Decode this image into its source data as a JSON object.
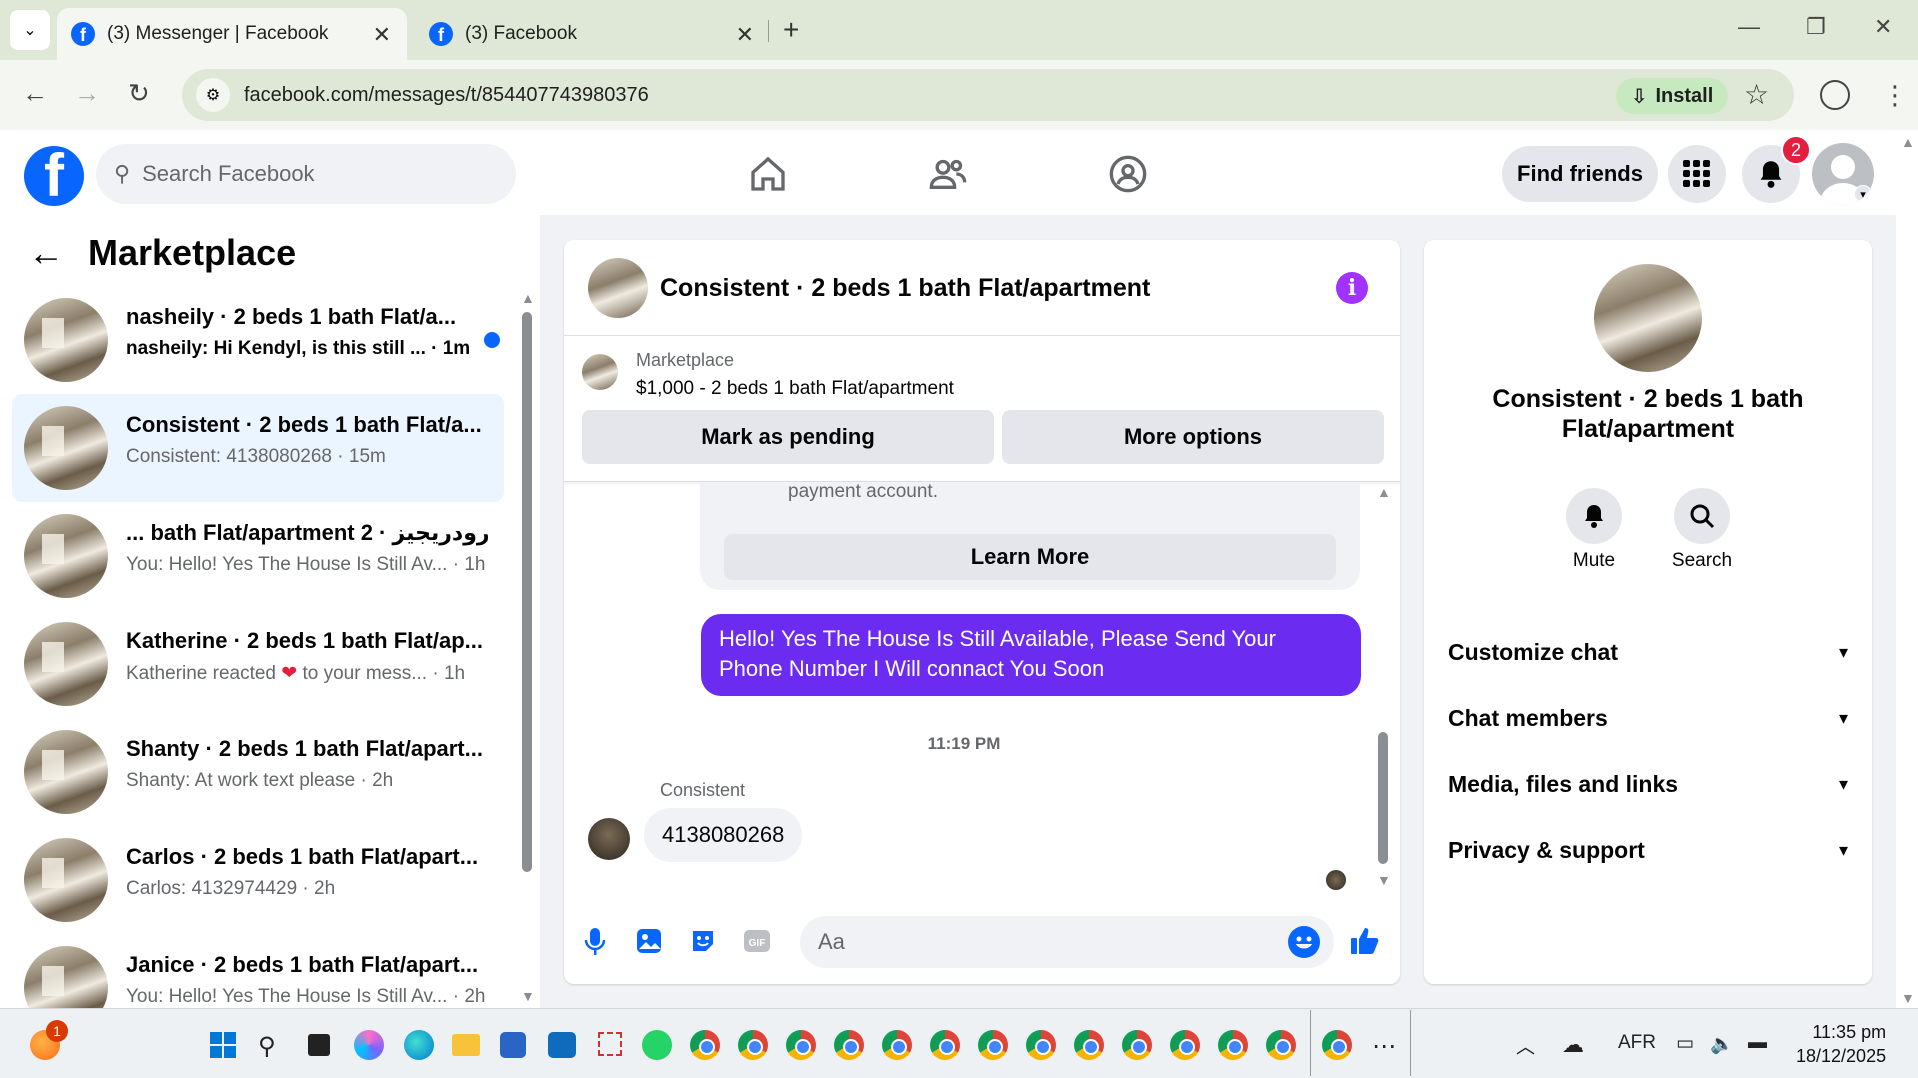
{
  "browser": {
    "tabs": [
      {
        "title": "(3) Messenger | Facebook",
        "active": true
      },
      {
        "title": "(3) Facebook",
        "active": false
      }
    ],
    "url": "facebook.com/messages/t/854407743980376",
    "install_label": "Install"
  },
  "fb": {
    "search_placeholder": "Search Facebook",
    "find_friends": "Find friends",
    "notification_count": "2",
    "brand_color": "#0866ff"
  },
  "sidebar": {
    "title": "Marketplace",
    "conversations": [
      {
        "title": "nasheily · 2 beds 1 bath Flat/a...",
        "preview": "nasheily: Hi Kendyl, is this still ... · 1m",
        "unread": true
      },
      {
        "title": "Consistent · 2 beds 1 bath Flat/a...",
        "preview": "Consistent: 4138080268 · 15m",
        "selected": true
      },
      {
        "title": "... bath Flat/apartment 2 · رودريجيز",
        "preview": "You: Hello! Yes The House Is Still Av... · 1h"
      },
      {
        "title": "Katherine · 2 beds 1 bath Flat/ap...",
        "preview_a": "Katherine reacted",
        "preview_b": "to your mess... · 1h"
      },
      {
        "title": "Shanty · 2 beds 1 bath Flat/apart...",
        "preview": "Shanty: At work text please · 2h"
      },
      {
        "title": "Carlos · 2 beds 1 bath Flat/apart...",
        "preview": "Carlos: 4132974429 · 2h"
      },
      {
        "title": "Janice · 2 beds 1 bath Flat/apart...",
        "preview": "You: Hello! Yes The House Is Still Av... · 2h"
      }
    ]
  },
  "chat": {
    "title": "Consistent · 2 beds 1 bath Flat/apartment",
    "marketplace_label": "Marketplace",
    "listing": "$1,000 - 2 beds 1 bath Flat/apartment",
    "mark_pending": "Mark as pending",
    "more_options": "More options",
    "system_text": "Watch out for fake emails or requests to upgrade your payment account.",
    "learn_more": "Learn More",
    "outgoing": "Hello! Yes The House  Is Still Available, Please Send Your Phone Number I Will connact You Soon",
    "timestamp": "11:19 PM",
    "sender": "Consistent",
    "incoming": "4138080268",
    "composer_placeholder": "Aa",
    "outgoing_color": "#6b2bf0"
  },
  "info": {
    "name": "Consistent · 2 beds 1 bath Flat/apartment",
    "mute": "Mute",
    "search": "Search",
    "sections": [
      "Customize chat",
      "Chat members",
      "Media, files and links",
      "Privacy & support"
    ]
  },
  "taskbar": {
    "start_badge": "1",
    "language": "AFR",
    "time": "11:35 pm",
    "date": "18/12/2025"
  }
}
